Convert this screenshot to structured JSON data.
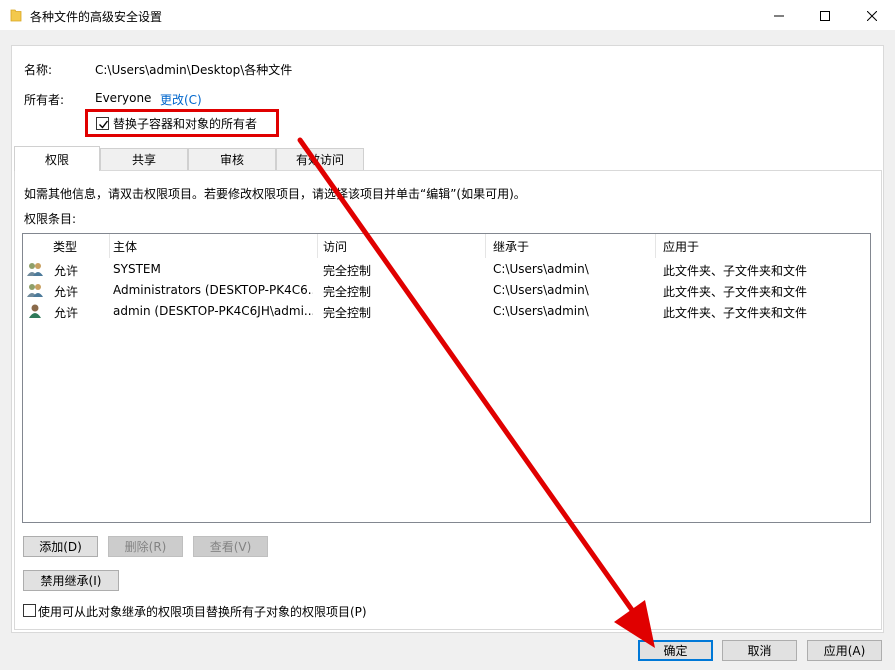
{
  "window": {
    "title": "各种文件的高级安全设置",
    "minimize_glyph": "—",
    "maximize_glyph": "☐",
    "close_glyph": "✕"
  },
  "owner": {
    "name_label": "名称:",
    "name_value": "C:\\Users\\admin\\Desktop\\各种文件",
    "owner_label": "所有者:",
    "owner_value": "Everyone",
    "change_link": "更改(C)",
    "replace_owner_label": "替换子容器和对象的所有者",
    "replace_owner_checked": true
  },
  "tabs": [
    {
      "label": "权限",
      "active": true
    },
    {
      "label": "共享",
      "active": false
    },
    {
      "label": "审核",
      "active": false
    },
    {
      "label": "有效访问",
      "active": false
    }
  ],
  "permissions": {
    "info_text": "如需其他信息，请双击权限项目。若要修改权限项目，请选择该项目并单击“编辑”(如果可用)。",
    "entries_label": "权限条目:",
    "columns": [
      "类型",
      "主体",
      "访问",
      "继承于",
      "应用于"
    ],
    "rows": [
      {
        "icon": "group-users-icon",
        "type": "允许",
        "principal": "SYSTEM",
        "access": "完全控制",
        "inherited_from": "C:\\Users\\admin\\",
        "applies_to": "此文件夹、子文件夹和文件"
      },
      {
        "icon": "group-users-icon",
        "type": "允许",
        "principal": "Administrators (DESKTOP-PK4C6...",
        "access": "完全控制",
        "inherited_from": "C:\\Users\\admin\\",
        "applies_to": "此文件夹、子文件夹和文件"
      },
      {
        "icon": "single-user-icon",
        "type": "允许",
        "principal": "admin (DESKTOP-PK4C6JH\\admi...",
        "access": "完全控制",
        "inherited_from": "C:\\Users\\admin\\",
        "applies_to": "此文件夹、子文件夹和文件"
      }
    ],
    "add_button": "添加(D)",
    "remove_button": "删除(R)",
    "view_button": "查看(V)",
    "disable_inheritance_button": "禁用继承(I)",
    "replace_child_label": "使用可从此对象继承的权限项目替换所有子对象的权限项目(P)",
    "replace_child_checked": false
  },
  "footer": {
    "ok_button": "确定",
    "cancel_button": "取消",
    "apply_button": "应用(A)"
  },
  "colors": {
    "annotation_red": "#e00000",
    "link_blue": "#0066cc",
    "default_button_border": "#0078d7"
  }
}
